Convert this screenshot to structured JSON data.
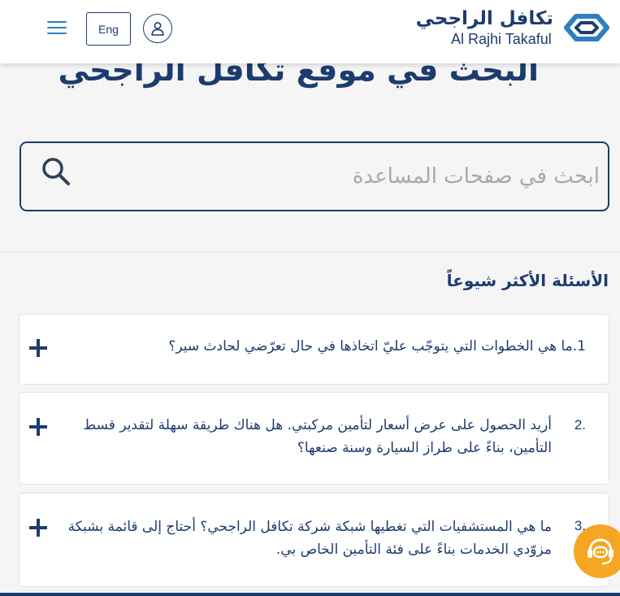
{
  "header": {
    "lang_label": "Eng",
    "logo_ar": "تكافل الراجحي",
    "logo_en": "Al Rajhi Takaful"
  },
  "page": {
    "title": "البحث في موقع تكافل الراجحي"
  },
  "search": {
    "placeholder": "ابحث في صفحات المساعدة"
  },
  "faq": {
    "heading": "الأسئلة الأكثر شيوعاً",
    "items": [
      {
        "text": "1.ما هي الخطوات التي يتوجّب عليّ اتخاذها في حال تعرّضي لحادث سير؟"
      },
      {
        "number": "2.",
        "text": "أريد الحصول على عرض أسعار لتأمين مركبتي. هل هناك طريقة سهلة لتقدير قسط التأمين، بناءً على طراز السيارة وسنة صنعها؟"
      },
      {
        "number": "3.",
        "text": "ما هي المستشفيات التي تغطيها شبكة شركة تكافل الراجحي؟ أحتاج إلى قائمة بشبكة مزوّدي الخدمات بناءً على فئة التأمين الخاص بي."
      }
    ]
  },
  "colors": {
    "brand_navy": "#1d3c6e",
    "accent_blue": "#2d7fc1",
    "chat_orange": "#f5a623"
  },
  "icons": {
    "menu": "hamburger-icon",
    "user": "user-icon",
    "search": "search-icon",
    "expand": "plus-icon",
    "chat": "headset-chat-icon"
  }
}
